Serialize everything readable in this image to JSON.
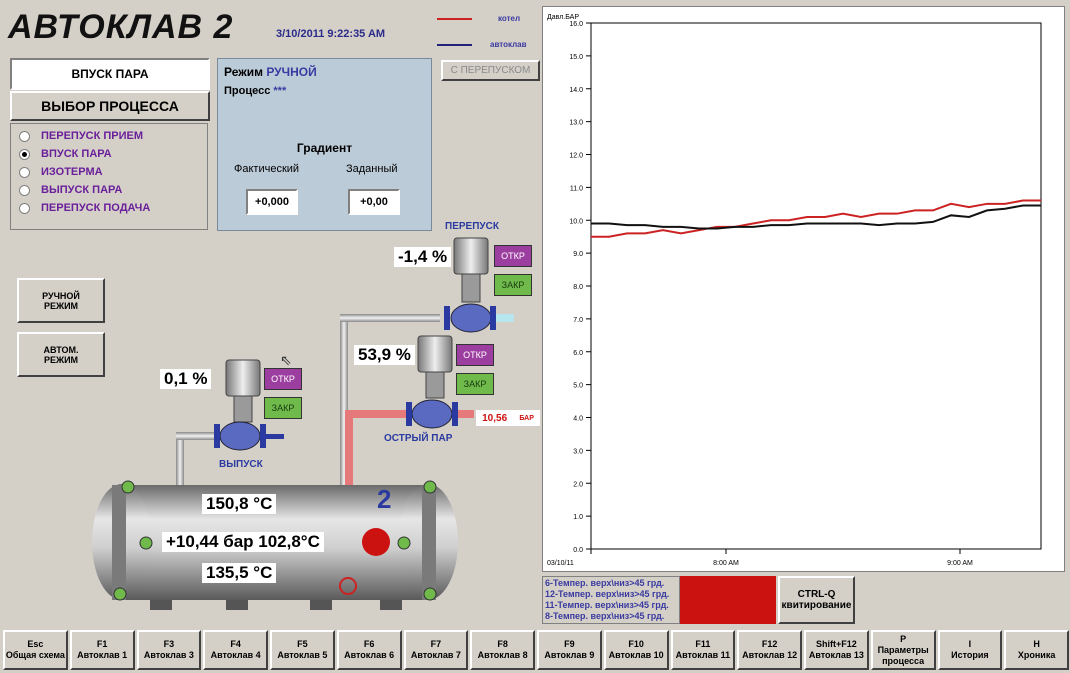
{
  "header": {
    "title": "АВТОКЛАВ 2",
    "datetime": "3/10/2011 9:22:35 AM"
  },
  "legend": [
    {
      "label": "котел",
      "color": "#cc2222"
    },
    {
      "label": "автоклав",
      "color": "#22227a"
    }
  ],
  "left_panel": {
    "inlet_button": "ВПУСК ПАРА",
    "process_select_label": "ВЫБОР ПРОЦЕССА",
    "processes": [
      "ПЕРЕПУСК ПРИЕМ",
      "ВПУСК ПАРА",
      "ИЗОТЕРМА",
      "ВЫПУСК ПАРА",
      "ПЕРЕПУСК ПОДАЧА"
    ],
    "selected_process_index": 1,
    "manual_mode_button": "РУЧНОЙ РЕЖИМ",
    "auto_mode_button": "АВТОМ. РЕЖИМ"
  },
  "mode_panel": {
    "mode_label": "Режим",
    "mode_value": "РУЧНОЙ",
    "process_label": "Процесс",
    "process_value": "***",
    "gradient_title": "Градиент",
    "actual_label": "Фактический",
    "setpoint_label": "Заданный",
    "actual_value": "+0,000",
    "setpoint_value": "+0,00"
  },
  "bypass_toggle": "С ПЕРЕПУСКОМ",
  "valves": {
    "bypass": {
      "label": "ПЕРЕПУСК",
      "percent": "-1,4  %",
      "open": "ОТКР",
      "close": "ЗАКР"
    },
    "steam": {
      "label": "ОСТРЫЙ  ПАР",
      "percent": "53,9 %",
      "open": "ОТКР",
      "close": "ЗАКР"
    },
    "exhaust": {
      "label": "ВЫПУСК",
      "percent": "0,1   %",
      "open": "ОТКР",
      "close": "ЗАКР"
    }
  },
  "boiler_pressure": {
    "value": "10,56",
    "unit": "БАР"
  },
  "autoclave": {
    "number": "2",
    "temp_top": "150,8 °C",
    "pressure_line": "+10,44 бар  102,8°C",
    "temp_bottom": "135,5 °C"
  },
  "chart_data": {
    "type": "line",
    "ylabel": "Давл.БАР",
    "ylim": [
      0.0,
      16.0
    ],
    "yticks": [
      "0.0",
      "1.0",
      "2.0",
      "3.0",
      "4.0",
      "5.0",
      "6.0",
      "7.0",
      "8.0",
      "9.0",
      "10.0",
      "11.0",
      "12.0",
      "13.0",
      "14.0",
      "15.0",
      "16.0"
    ],
    "xticks": [
      "03/10/11",
      "8:00 AM",
      "9:00 AM"
    ],
    "series": [
      {
        "name": "котел",
        "color": "#cc2222",
        "x": [
          0,
          4,
          8,
          12,
          16,
          20,
          24,
          28,
          32,
          36,
          40,
          44,
          48,
          52,
          56,
          60,
          64,
          68,
          72,
          76,
          80,
          84,
          88,
          92,
          96,
          100
        ],
        "y": [
          9.5,
          9.5,
          9.6,
          9.6,
          9.7,
          9.6,
          9.7,
          9.8,
          9.8,
          9.9,
          10.0,
          10.0,
          10.1,
          10.1,
          10.2,
          10.1,
          10.2,
          10.2,
          10.3,
          10.3,
          10.5,
          10.4,
          10.5,
          10.5,
          10.6,
          10.6
        ]
      },
      {
        "name": "автоклав",
        "color": "#111111",
        "x": [
          0,
          4,
          8,
          12,
          16,
          20,
          24,
          28,
          32,
          36,
          40,
          44,
          48,
          52,
          56,
          60,
          64,
          68,
          72,
          76,
          80,
          84,
          88,
          92,
          96,
          100
        ],
        "y": [
          9.9,
          9.9,
          9.85,
          9.85,
          9.8,
          9.8,
          9.75,
          9.75,
          9.8,
          9.8,
          9.85,
          9.85,
          9.9,
          9.9,
          9.9,
          9.9,
          9.85,
          9.9,
          9.9,
          9.95,
          10.15,
          10.1,
          10.3,
          10.35,
          10.45,
          10.45
        ]
      }
    ]
  },
  "alarms": {
    "lines": [
      "6-Темпер. верх\\низ>45 грд.",
      "12-Темпер. верх\\низ>45 грд.",
      "11-Темпер. верх\\низ>45 грд.",
      "8-Темпер. верх\\низ>45 грд."
    ],
    "ack_key": "CTRL-Q",
    "ack_label": "квитирование",
    "indicator_color": "#cc1111"
  },
  "function_keys": [
    {
      "key": "Esc",
      "label": "Общая схема"
    },
    {
      "key": "F1",
      "label": "Автоклав 1"
    },
    {
      "key": "F3",
      "label": "Автоклав 3"
    },
    {
      "key": "F4",
      "label": "Автоклав 4"
    },
    {
      "key": "F5",
      "label": "Автоклав 5"
    },
    {
      "key": "F6",
      "label": "Автоклав 6"
    },
    {
      "key": "F7",
      "label": "Автоклав 7"
    },
    {
      "key": "F8",
      "label": "Автоклав 8"
    },
    {
      "key": "F9",
      "label": "Автоклав 9"
    },
    {
      "key": "F10",
      "label": "Автоклав 10"
    },
    {
      "key": "F11",
      "label": "Автоклав 11"
    },
    {
      "key": "F12",
      "label": "Автоклав 12"
    },
    {
      "key": "Shift+F12",
      "label": "Автоклав 13"
    },
    {
      "key": "P",
      "label": "Параметры процесса"
    },
    {
      "key": "I",
      "label": "История"
    },
    {
      "key": "H",
      "label": "Хроника"
    }
  ]
}
